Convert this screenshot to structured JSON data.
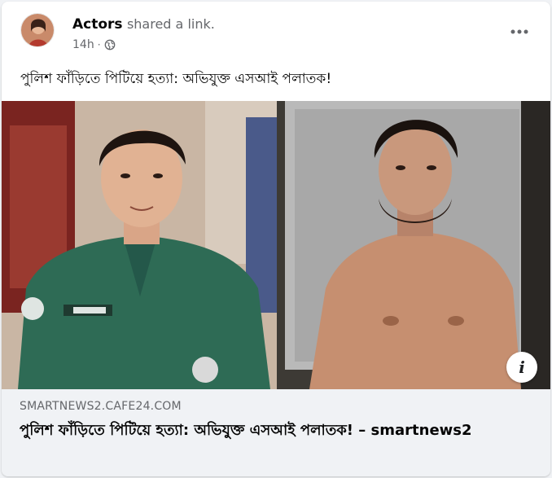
{
  "post": {
    "author": "Actors",
    "action": "shared a link.",
    "time": "14h",
    "dot": "·",
    "privacy_icon": "globe-icon",
    "more_icon": "more-horizontal-icon",
    "caption": "পুলিশ ফাঁড়িতে পিটিয়ে হত্যা: অভিযুক্ত এসআই পলাতক!"
  },
  "link_preview": {
    "domain": "SMARTNEWS2.CAFE24.COM",
    "title": "পুলিশ ফাঁড়িতে পিটিয়ে হত্যা: অভিযুক্ত এসআই পলাতক! – smartnews2",
    "info_label": "i"
  },
  "colors": {
    "background": "#f0f2f5",
    "card": "#ffffff",
    "secondary_text": "#65676b",
    "uniform": "#2e6b55"
  }
}
